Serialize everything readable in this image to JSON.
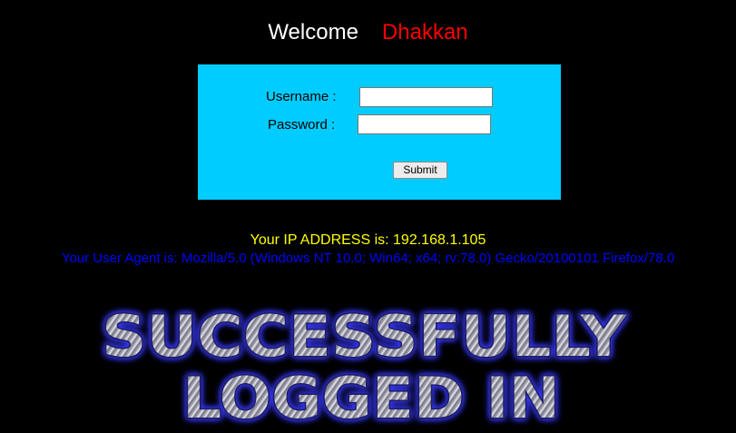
{
  "header": {
    "welcome_text": "Welcome",
    "username_text": "Dhakkan"
  },
  "login_form": {
    "username_label": "Username :",
    "password_label": "Password :",
    "username_value": "",
    "password_value": "",
    "submit_label": "Submit"
  },
  "info": {
    "ip_text": "Your IP ADDRESS is: 192.168.1.105",
    "user_agent_text": "Your User Agent is: Mozilla/5.0 (Windows NT 10.0; Win64; x64; rv:78.0) Gecko/20100101 Firefox/78.0"
  },
  "banner": {
    "line1": "SUCCESSFULLY",
    "line2": "LOGGED IN"
  },
  "colors": {
    "background": "#000000",
    "form_background": "#00ccff",
    "welcome": "#ffffff",
    "username": "#ff0000",
    "ip_text": "#ffff00",
    "user_agent_text": "#0000ff",
    "banner_glow": "#3333ff"
  }
}
